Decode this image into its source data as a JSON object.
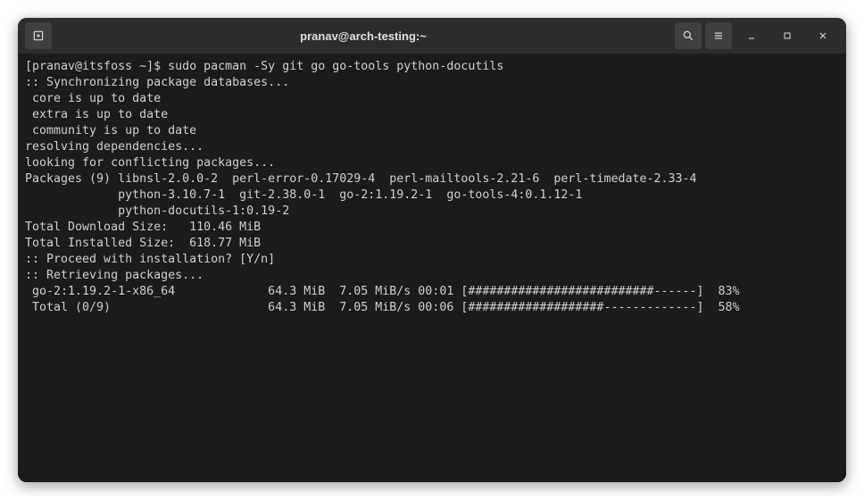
{
  "window": {
    "title": "pranav@arch-testing:~"
  },
  "prompt": {
    "text": "[pranav@itsfoss ~]$ ",
    "command": "sudo pacman -Sy git go go-tools python-docutils"
  },
  "lines": {
    "sync": ":: Synchronizing package databases...",
    "core": " core is up to date",
    "extra": " extra is up to date",
    "community": " community is up to date",
    "resolving": "resolving dependencies...",
    "looking": "looking for conflicting packages...",
    "blank": "",
    "pkgs1": "Packages (9) libnsl-2.0.0-2  perl-error-0.17029-4  perl-mailtools-2.21-6  perl-timedate-2.33-4",
    "pkgs2": "             python-3.10.7-1  git-2.38.0-1  go-2:1.19.2-1  go-tools-4:0.1.12-1",
    "pkgs3": "             python-docutils-1:0.19-2",
    "dlsize": "Total Download Size:   110.46 MiB",
    "inssize": "Total Installed Size:  618.77 MiB",
    "proceed": ":: Proceed with installation? [Y/n]",
    "retrieving": ":: Retrieving packages...",
    "prog1": " go-2:1.19.2-1-x86_64             64.3 MiB  7.05 MiB/s 00:01 [##########################------]  83%",
    "prog2": " Total (0/9)                      64.3 MiB  7.05 MiB/s 00:06 [###################-------------]  58%"
  }
}
